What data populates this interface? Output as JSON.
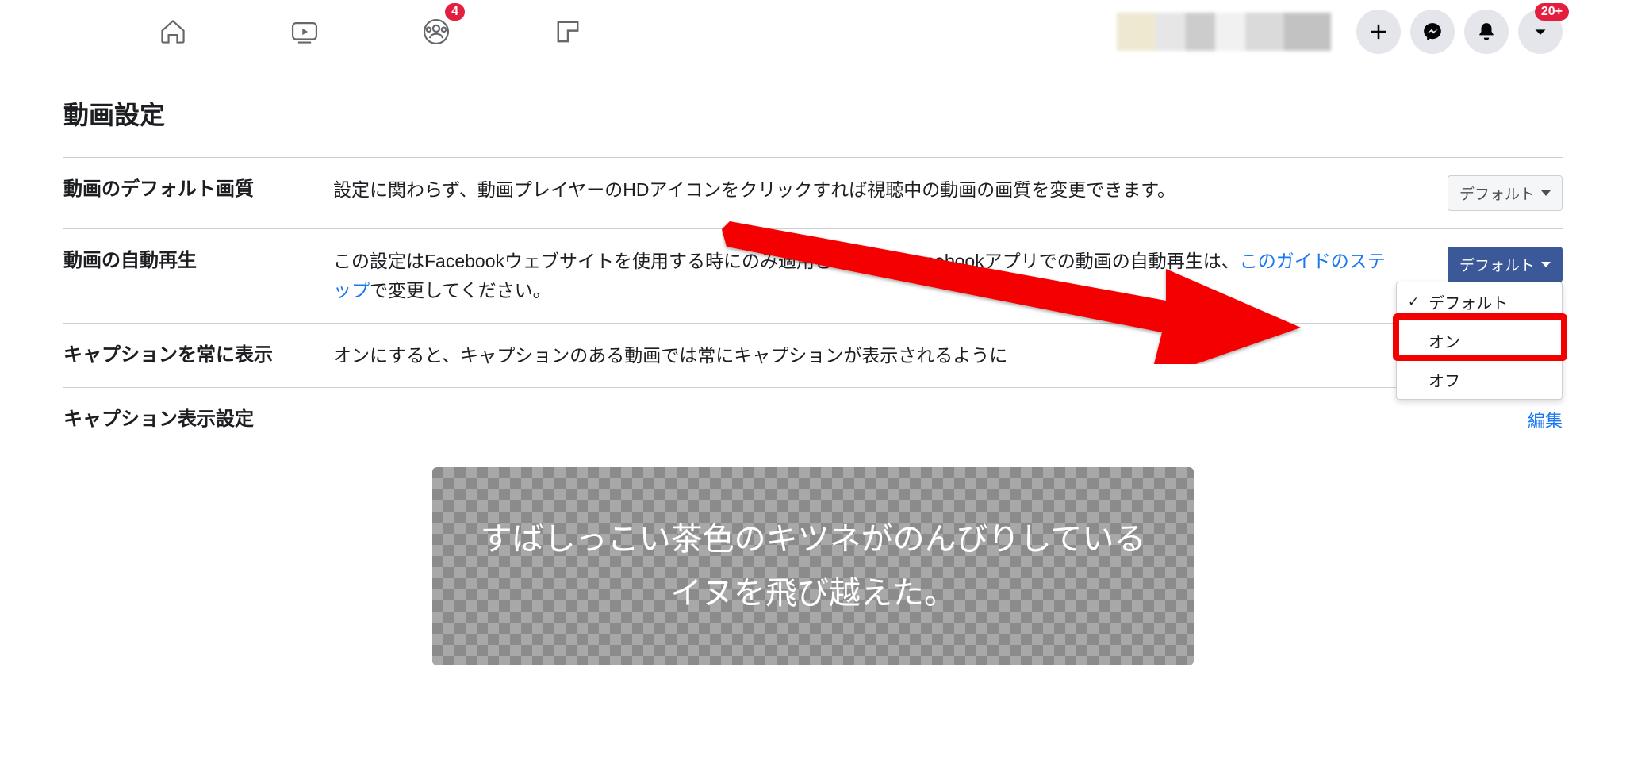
{
  "topnav": {
    "groups_badge": "4",
    "account_badge": "20+"
  },
  "page": {
    "title": "動画設定"
  },
  "rows": {
    "quality": {
      "label": "動画のデフォルト画質",
      "desc": "設定に関わらず、動画プレイヤーのHDアイコンをクリックすれば視聴中の動画の画質を変更できます。",
      "value": "デフォルト"
    },
    "autoplay": {
      "label": "動画の自動再生",
      "desc_prefix": "この設定はFacebookウェブサイトを使用する時にのみ適用されます。Facebookアプリでの動画の自動再生は、",
      "link": "このガイドのステップ",
      "desc_suffix": "で変更してください。",
      "value": "デフォルト",
      "options": {
        "default": "デフォルト",
        "on": "オン",
        "off": "オフ"
      }
    },
    "captions_always": {
      "label": "キャプションを常に表示",
      "desc": "オンにすると、キャプションのある動画では常にキャプションが表示されるように"
    },
    "caption_display": {
      "label": "キャプション表示設定",
      "edit": "編集"
    }
  },
  "preview": {
    "text": "すばしっこい茶色のキツネがのんびりしているイヌを飛び越えた。"
  }
}
